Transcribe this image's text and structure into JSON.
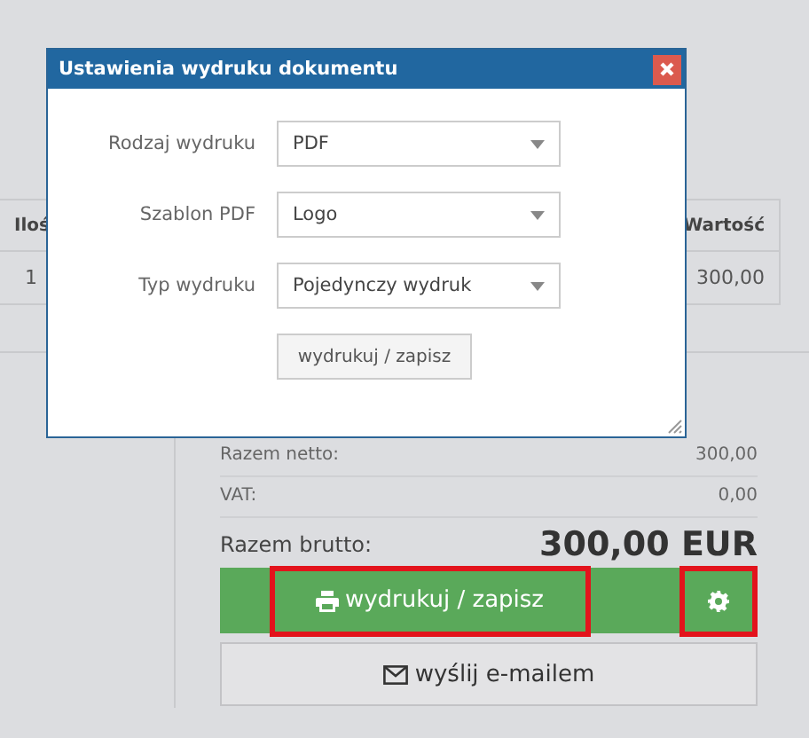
{
  "background": {
    "table": {
      "columns": [
        "Iloś",
        "Wartość"
      ],
      "rows": [
        [
          "1",
          "300,00"
        ]
      ]
    },
    "summary": {
      "lines": [
        {
          "label": "Razem netto:",
          "value": "300,00"
        },
        {
          "label": "VAT:",
          "value": "0,00"
        }
      ],
      "total": {
        "label": "Razem brutto:",
        "value": "300,00 EUR"
      },
      "print_button": {
        "label": "wydrukuj / zapisz",
        "highlighted": true
      },
      "settings_button": {
        "highlighted": true
      },
      "email_button": {
        "label": "wyślij e-mailem"
      }
    }
  },
  "dialog": {
    "title": "Ustawienia wydruku dokumentu",
    "fields": [
      {
        "label": "Rodzaj wydruku",
        "value": "PDF"
      },
      {
        "label": "Szablon PDF",
        "value": "Logo"
      },
      {
        "label": "Typ wydruku",
        "value": "Pojedynczy wydruk"
      }
    ],
    "submit": "wydrukuj / zapisz"
  }
}
